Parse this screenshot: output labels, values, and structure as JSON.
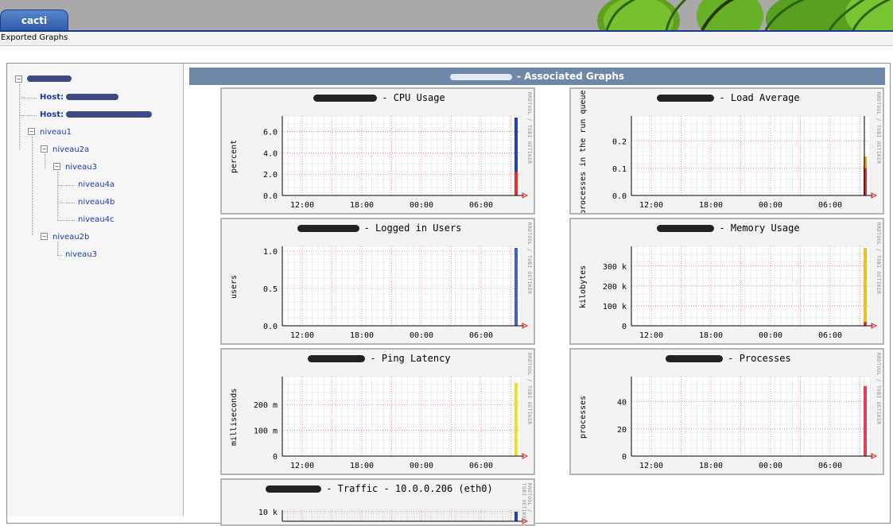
{
  "app": {
    "tab_label": "cacti"
  },
  "breadcrumb": "Exported Graphs",
  "tree": {
    "items": [
      {
        "label": "",
        "redacted": true,
        "bold": true
      },
      {
        "label": "Host: ",
        "redacted": true,
        "bold": true
      },
      {
        "label": "Host: ",
        "redacted": true,
        "bold": true
      },
      {
        "label": "niveau1"
      },
      {
        "label": "niveau2a"
      },
      {
        "label": "niveau3"
      },
      {
        "label": "niveau4a"
      },
      {
        "label": "niveau4b"
      },
      {
        "label": "niveau4c"
      },
      {
        "label": "niveau2b"
      },
      {
        "label": "niveau3"
      }
    ]
  },
  "header": {
    "title": "- Associated Graphs"
  },
  "graphs": [
    {
      "title": "- CPU Usage",
      "ylabel": "percent",
      "yticks": [
        "0.0",
        "2.0",
        "4.0",
        "6.0"
      ],
      "xticks": [
        "12:00",
        "18:00",
        "00:00",
        "06:00"
      ],
      "rrd": "RRDTOOL / TOBI OETIKER"
    },
    {
      "title": "- Load Average",
      "ylabel": "processes in the run queue",
      "yticks": [
        "0.0",
        "0.1",
        "0.2"
      ],
      "xticks": [
        "12:00",
        "18:00",
        "00:00",
        "06:00"
      ],
      "rrd": "RRDTOOL / TOBI OETIKER"
    },
    {
      "title": "- Logged in Users",
      "ylabel": "users",
      "yticks": [
        "0.0",
        "0.5",
        "1.0"
      ],
      "xticks": [
        "12:00",
        "18:00",
        "00:00",
        "06:00"
      ],
      "rrd": "RRDTOOL / TOBI OETIKER"
    },
    {
      "title": "- Memory Usage",
      "ylabel": "kilobytes",
      "yticks": [
        "0",
        "100 k",
        "200 k",
        "300 k"
      ],
      "xticks": [
        "12:00",
        "18:00",
        "00:00",
        "06:00"
      ],
      "rrd": "RRDTOOL / TOBI OETIKER"
    },
    {
      "title": "- Ping Latency",
      "ylabel": "milliseconds",
      "yticks": [
        "0",
        "100 m",
        "200 m"
      ],
      "xticks": [
        "12:00",
        "18:00",
        "00:00",
        "06:00"
      ],
      "rrd": "RRDTOOL / TOBI OETIKER"
    },
    {
      "title": "- Processes",
      "ylabel": "processes",
      "yticks": [
        "0",
        "20",
        "40"
      ],
      "xticks": [
        "12:00",
        "18:00",
        "00:00",
        "06:00"
      ],
      "rrd": "RRDTOOL / TOBI OETIKER"
    },
    {
      "title": "- Traffic - 10.0.0.206 (eth0)",
      "ylabel": "",
      "yticks": [
        "10 k"
      ],
      "xticks": [],
      "rrd": "RRDTOOL / TOBI OETIKER"
    }
  ],
  "colors": {
    "header_bg": "#6e88aa",
    "tab_bg": "#2b5aa8",
    "grid_major": "#e04040",
    "grid_minor": "#c8c8c8",
    "cpu_series": [
      "#2040c0",
      "#e03030"
    ],
    "users_series": "#4060d0",
    "memory_series": [
      "#f0c020",
      "#e03030"
    ],
    "ping_series": "#f0e020",
    "processes_series": "#e04050",
    "load_series": [
      "#000000",
      "#e03030",
      "#f0a020"
    ]
  },
  "icons": {
    "tree_expand": "minus-box-icon",
    "axis_arrow": "red-arrow-icon"
  }
}
